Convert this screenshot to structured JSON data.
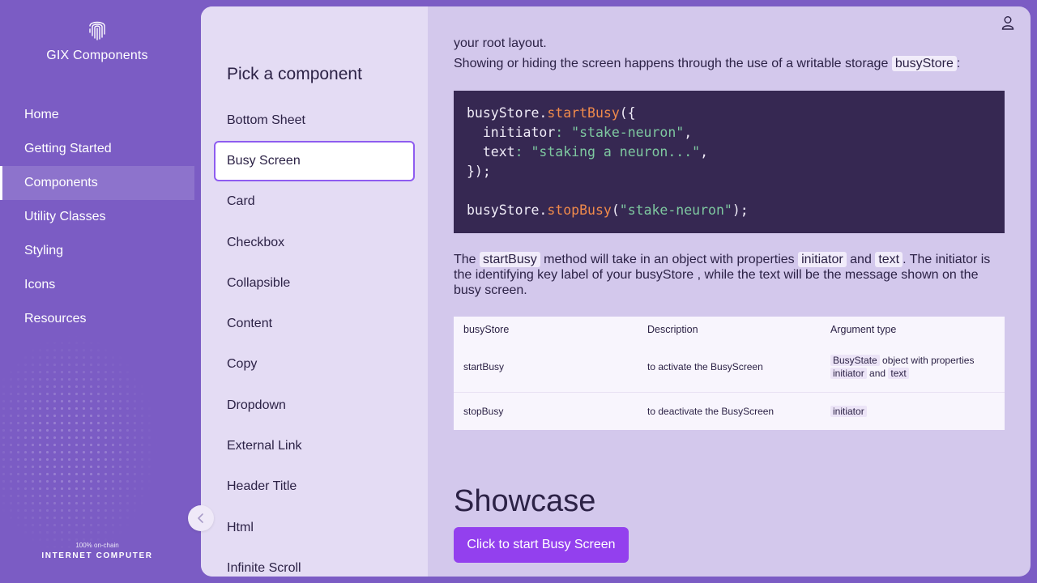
{
  "app": {
    "name": "GIX Components"
  },
  "sidebar": {
    "items": [
      {
        "label": "Home"
      },
      {
        "label": "Getting Started"
      },
      {
        "label": "Components"
      },
      {
        "label": "Utility Classes"
      },
      {
        "label": "Styling"
      },
      {
        "label": "Icons"
      },
      {
        "label": "Resources"
      }
    ],
    "active": "Components",
    "footer": {
      "small": "100% on-chain",
      "big": "INTERNET COMPUTER"
    }
  },
  "picker": {
    "title": "Pick a component",
    "items": [
      {
        "label": "Bottom Sheet"
      },
      {
        "label": "Busy Screen"
      },
      {
        "label": "Card"
      },
      {
        "label": "Checkbox"
      },
      {
        "label": "Collapsible"
      },
      {
        "label": "Content"
      },
      {
        "label": "Copy"
      },
      {
        "label": "Dropdown"
      },
      {
        "label": "External Link"
      },
      {
        "label": "Header Title"
      },
      {
        "label": "Html"
      },
      {
        "label": "Infinite Scroll"
      }
    ],
    "active": "Busy Screen"
  },
  "content": {
    "intro_tail": "your root layout.",
    "intro_a": "Showing or hiding the screen happens through the use of a writable storage",
    "intro_code": "busyStore",
    "intro_end": ":",
    "code": {
      "l1_obj": "busyStore.",
      "l1_fn": "startBusy",
      "l1_end": "({",
      "l2_key": "  initiator",
      "l2_colon": ": ",
      "l2_val": "\"stake-neuron\"",
      "l2_end": ",",
      "l3_key": "  text",
      "l3_colon": ": ",
      "l3_val": "\"staking a neuron...\"",
      "l3_end": ",",
      "l4": "});",
      "l6_obj": "busyStore.",
      "l6_fn": "stopBusy",
      "l6_paren": "(",
      "l6_val": "\"stake-neuron\"",
      "l6_end": ");"
    },
    "para": {
      "a": "The",
      "code1": "startBusy",
      "b": "method will take in an object with properties",
      "code2": "initiator",
      "c": "and",
      "code3": "text",
      "d": ". The initiator is the identifying key label of your busyStore , while the text will be the message shown on the busy screen."
    },
    "table": {
      "headers": [
        "busyStore",
        "Description",
        "Argument type"
      ],
      "rows": [
        {
          "name": "startBusy",
          "desc": "to activate the BusyScreen",
          "arg_tag": "BusyState",
          "arg_text": "object with properties",
          "arg_tag2": "initiator",
          "arg_and": "and",
          "arg_tag3": "text"
        },
        {
          "name": "stopBusy",
          "desc": "to deactivate the BusyScreen",
          "arg_tag": "initiator"
        }
      ]
    },
    "showcase_title": "Showcase",
    "button_label": "Click to start Busy Screen"
  },
  "colors": {
    "accent": "#9340ee",
    "sidebar_bg": "#7b5cc4",
    "code_bg": "#362852"
  },
  "icons": {
    "logo": "fingerprint-icon",
    "collapse": "chevron-left-icon",
    "account": "user-icon"
  }
}
